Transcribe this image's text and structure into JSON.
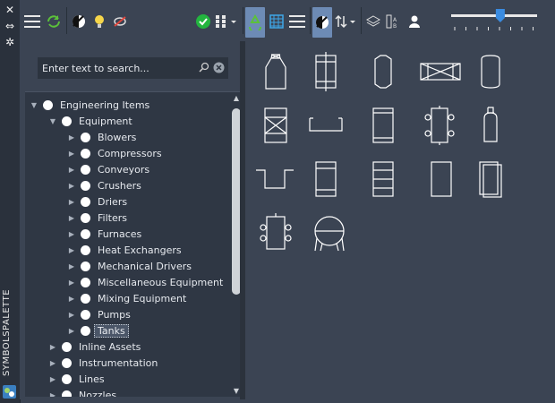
{
  "side_panel": {
    "title": "SYMBOLSPALETTE",
    "icons": [
      "close-icon",
      "auto-hide-icon",
      "settings-icon",
      "palette-app-icon"
    ]
  },
  "toolbar": {
    "left_icons": [
      "hamburger-menu-icon",
      "refresh-icon",
      "contrast-toggle-icon",
      "lightbulb-icon",
      "hide-icon",
      "checkmark-icon",
      "grid-view-dropdown-icon"
    ],
    "right_icons": [
      "recycle-icon",
      "table-view-icon",
      "list-view-icon",
      "contrast-toggle-icon",
      "sort-dropdown-icon",
      "layers-icon",
      "text-style-icon",
      "user-icon"
    ],
    "slider_value": 0.58
  },
  "search": {
    "placeholder": "Enter text to search..."
  },
  "tree": {
    "root": "Engineering Items",
    "equipment": "Equipment",
    "equipment_children": [
      "Blowers",
      "Compressors",
      "Conveyors",
      "Crushers",
      "Driers",
      "Filters",
      "Furnaces",
      "Heat Exchangers",
      "Mechanical Drivers",
      "Miscellaneous Equipment",
      "Mixing Equipment",
      "Pumps",
      "Tanks"
    ],
    "selected": "Tanks",
    "siblings": [
      "Inline Assets",
      "Instrumentation",
      "Lines",
      "Nozzles"
    ]
  },
  "colors": {
    "accent": "#6d8bb5",
    "background": "#3b4453",
    "tree_bg": "#2f3744",
    "green_check": "#23b53f"
  }
}
